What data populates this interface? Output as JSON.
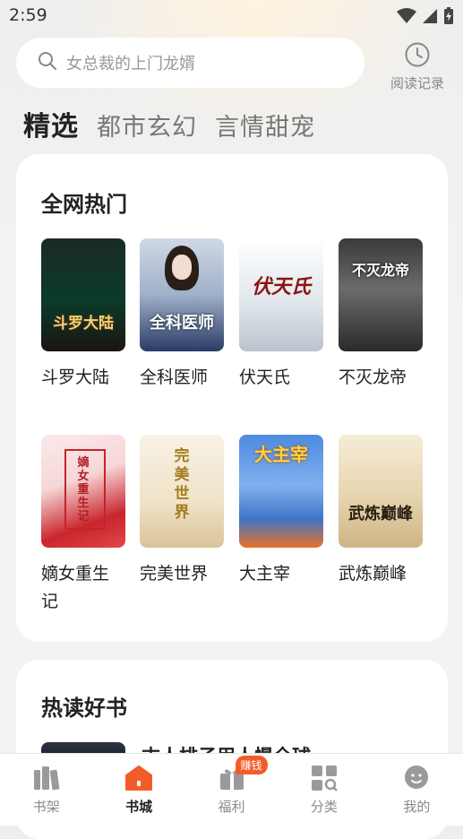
{
  "status_bar": {
    "time": "2:59",
    "icons": [
      "wifi-icon",
      "signal-icon",
      "battery-charging-icon"
    ]
  },
  "search": {
    "placeholder": "女总裁的上门龙婿",
    "icon": "search-icon"
  },
  "history": {
    "label": "阅读记录",
    "icon": "clock-icon"
  },
  "tabs": [
    {
      "label": "精选",
      "active": true
    },
    {
      "label": "都市玄幻",
      "active": false
    },
    {
      "label": "言情甜宠",
      "active": false
    }
  ],
  "section_hot": {
    "title": "全网热门",
    "books": [
      {
        "name": "斗罗大陆",
        "cover_text": "斗罗大陆"
      },
      {
        "name": "全科医师",
        "cover_text": "全科医师"
      },
      {
        "name": "伏天氏",
        "cover_text": "伏天氏"
      },
      {
        "name": "不灭龙帝",
        "cover_text": "不灭龙帝"
      },
      {
        "name": "嫡女重生记",
        "cover_text": "嫡女重生记"
      },
      {
        "name": "完美世界",
        "cover_text": "完美世界"
      },
      {
        "name": "大主宰",
        "cover_text": "大主宰"
      },
      {
        "name": "武炼巅峰",
        "cover_text": "武炼巅峰"
      }
    ]
  },
  "section_reading": {
    "title": "热读好书",
    "first_book_title": "末人排子用人慢全球"
  },
  "bottom_nav": [
    {
      "label": "书架",
      "icon": "bookshelf-icon",
      "active": false
    },
    {
      "label": "书城",
      "icon": "bookstore-icon",
      "active": true
    },
    {
      "label": "福利",
      "icon": "gift-icon",
      "active": false,
      "badge": "赚钱"
    },
    {
      "label": "分类",
      "icon": "category-icon",
      "active": false
    },
    {
      "label": "我的",
      "icon": "profile-icon",
      "active": false
    }
  ],
  "colors": {
    "accent": "#f25c2a",
    "badge": "#f25c2a"
  }
}
